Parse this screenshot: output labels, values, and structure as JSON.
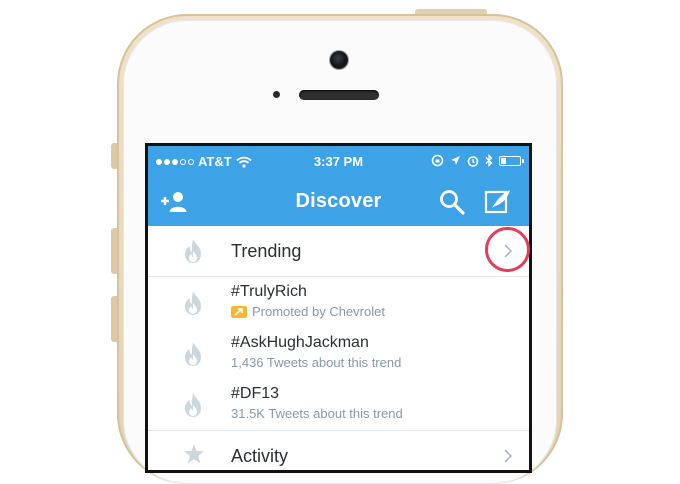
{
  "status_bar": {
    "carrier": "AT&T",
    "time": "3:37 PM",
    "signal_bars_filled": 3,
    "signal_bars_total": 5
  },
  "nav": {
    "title": "Discover",
    "left_icon": "add-user-icon",
    "right_icons": [
      "search-icon",
      "compose-tweet-icon"
    ]
  },
  "trending_header": {
    "label": "Trending",
    "icon": "flame-icon"
  },
  "trends": [
    {
      "title": "#TrulyRich",
      "subtitle": "Promoted by Chevrolet",
      "promoted": true
    },
    {
      "title": "#AskHughJackman",
      "subtitle": "1,436 Tweets about this trend",
      "promoted": false
    },
    {
      "title": "#DF13",
      "subtitle": "31.5K Tweets about this trend",
      "promoted": false
    }
  ],
  "activity": {
    "label": "Activity",
    "icon": "star-icon"
  },
  "colors": {
    "accent": "#3ea2e6",
    "highlight_ring": "#e0405e",
    "promoted_badge": "#f5b82e",
    "device_frame": "#e8d9bc"
  }
}
